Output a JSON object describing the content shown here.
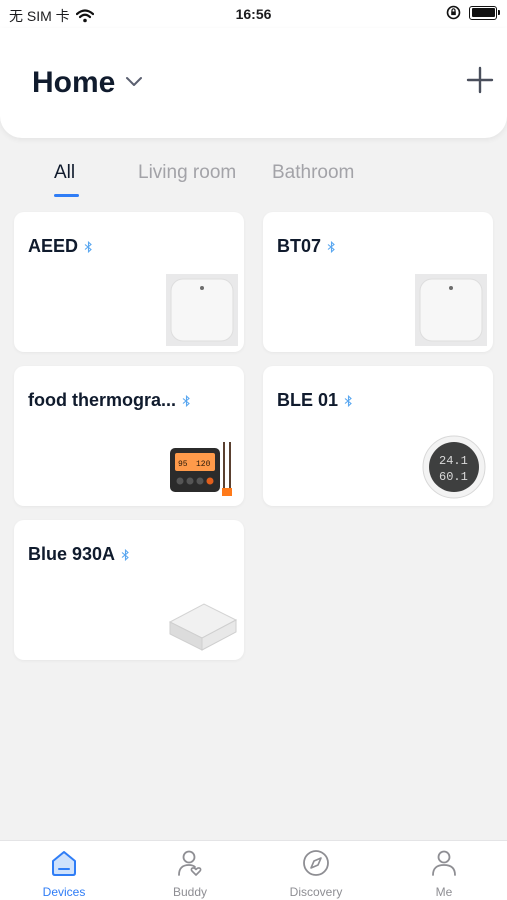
{
  "status_bar": {
    "carrier": "无 SIM 卡",
    "time": "16:56"
  },
  "header": {
    "title": "Home"
  },
  "tabs": [
    {
      "label": "All",
      "active": true
    },
    {
      "label": "Living room",
      "active": false
    },
    {
      "label": "Bathroom",
      "active": false
    }
  ],
  "devices": [
    {
      "name": "AEED",
      "icon": "gateway-square"
    },
    {
      "name": "BT07",
      "icon": "gateway-square"
    },
    {
      "name": "food thermogra...",
      "icon": "food-thermometer"
    },
    {
      "name": "BLE 01",
      "icon": "thermo-hygrometer",
      "reading_top": "24.1",
      "reading_bottom": "60.1"
    },
    {
      "name": "Blue 930A",
      "icon": "gateway-box"
    }
  ],
  "thermometer_display": {
    "left": "95",
    "right": "120"
  },
  "bottom_nav": [
    {
      "label": "Devices",
      "active": true
    },
    {
      "label": "Buddy",
      "active": false
    },
    {
      "label": "Discovery",
      "active": false
    },
    {
      "label": "Me",
      "active": false
    }
  ],
  "colors": {
    "accent": "#2f7df6",
    "title": "#101b2d",
    "background": "#f2f2f2"
  }
}
